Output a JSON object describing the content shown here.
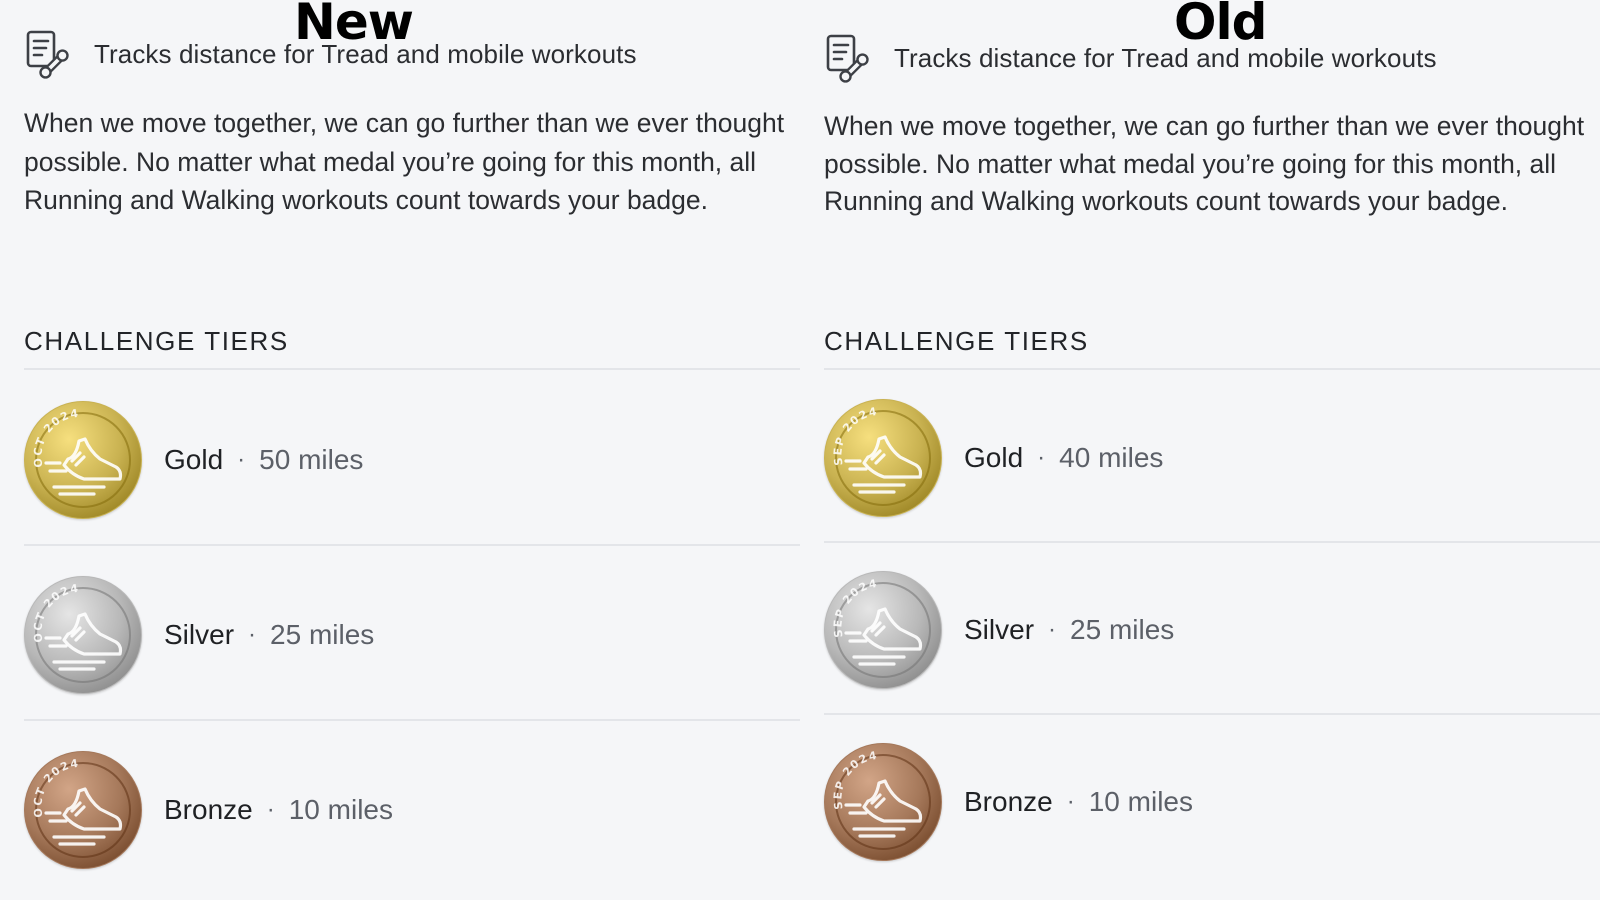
{
  "panels": [
    {
      "label": "New",
      "tracks_text": "Tracks distance for Tread and mobile workouts",
      "description": "When we move together, we can go further than we ever thought possible. No matter what medal you’re going for this month, all Running and Walking workouts count towards your badge.",
      "tiers_title": "CHALLENGE TIERS",
      "medal_text": "OCT 2024",
      "tiers": [
        {
          "name": "Gold",
          "separator": "·",
          "value": "50 miles",
          "color": "#c9b251"
        },
        {
          "name": "Silver",
          "separator": "·",
          "value": "25 miles",
          "color": "#b8b8b8"
        },
        {
          "name": "Bronze",
          "separator": "·",
          "value": "10 miles",
          "color": "#a5785a"
        }
      ]
    },
    {
      "label": "Old",
      "tracks_text": "Tracks distance for Tread and mobile workouts",
      "description": "When we move together, we can go further than we ever thought possible. No matter what medal you’re going for this month, all Running and Walking workouts count towards your badge.",
      "tiers_title": "CHALLENGE TIERS",
      "medal_text": "SEP 2024",
      "tiers": [
        {
          "name": "Gold",
          "separator": "·",
          "value": "40 miles",
          "color": "#c9b251"
        },
        {
          "name": "Silver",
          "separator": "·",
          "value": "25 miles",
          "color": "#b8b8b8"
        },
        {
          "name": "Bronze",
          "separator": "·",
          "value": "10 miles",
          "color": "#a5785a"
        }
      ]
    }
  ],
  "icons": {
    "tracks": "clipboard-dumbbell-icon",
    "medal": "running-shoe-medal-icon"
  }
}
